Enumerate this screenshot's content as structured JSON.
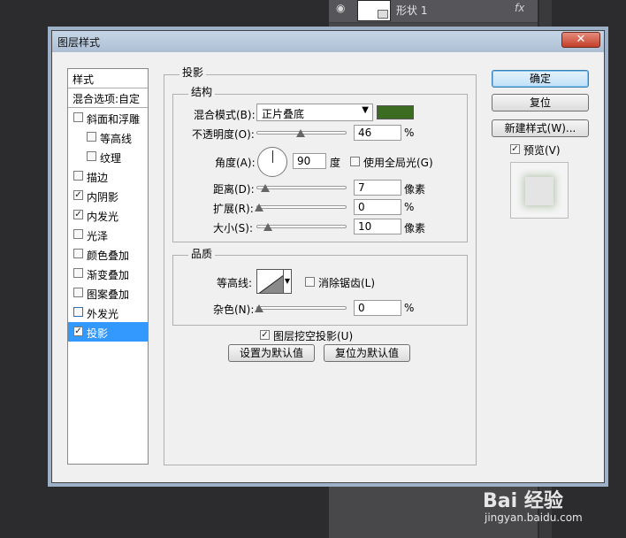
{
  "background": {
    "layer_name": "形状 1",
    "fx": "fx"
  },
  "dialog": {
    "title": "图层样式",
    "close": "✕"
  },
  "sidebar": {
    "header": "样式",
    "blend_options": "混合选项:自定",
    "items": [
      {
        "label": "斜面和浮雕",
        "checked": false
      },
      {
        "label": "等高线",
        "checked": false
      },
      {
        "label": "纹理",
        "checked": false
      },
      {
        "label": "描边",
        "checked": false
      },
      {
        "label": "内阴影",
        "checked": true
      },
      {
        "label": "内发光",
        "checked": true
      },
      {
        "label": "光泽",
        "checked": false
      },
      {
        "label": "颜色叠加",
        "checked": false
      },
      {
        "label": "渐变叠加",
        "checked": false
      },
      {
        "label": "图案叠加",
        "checked": false
      },
      {
        "label": "外发光",
        "checked": false
      },
      {
        "label": "投影",
        "checked": true,
        "selected": true
      }
    ]
  },
  "drop_shadow": {
    "title": "投影",
    "structure": {
      "title": "结构",
      "blend_mode_label": "混合模式(B):",
      "blend_mode": "正片叠底",
      "color": "#3c6b22",
      "opacity_label": "不透明度(O):",
      "opacity": "46",
      "opacity_unit": "%",
      "angle_label": "角度(A):",
      "angle": "90",
      "angle_unit": "度",
      "global_light": "使用全局光(G)",
      "distance_label": "距离(D):",
      "distance": "7",
      "distance_unit": "像素",
      "spread_label": "扩展(R):",
      "spread": "0",
      "spread_unit": "%",
      "size_label": "大小(S):",
      "size": "10",
      "size_unit": "像素"
    },
    "quality": {
      "title": "品质",
      "contour_label": "等高线:",
      "anti_aliased": "消除锯齿(L)",
      "noise_label": "杂色(N):",
      "noise": "0",
      "noise_unit": "%"
    },
    "knockout": "图层挖空投影(U)",
    "make_default": "设置为默认值",
    "reset_default": "复位为默认值"
  },
  "buttons": {
    "ok": "确定",
    "reset": "复位",
    "new_style": "新建样式(W)...",
    "preview": "预览(V)"
  },
  "watermark": {
    "logo": "Bai 经验",
    "url": "jingyan.baidu.com"
  }
}
